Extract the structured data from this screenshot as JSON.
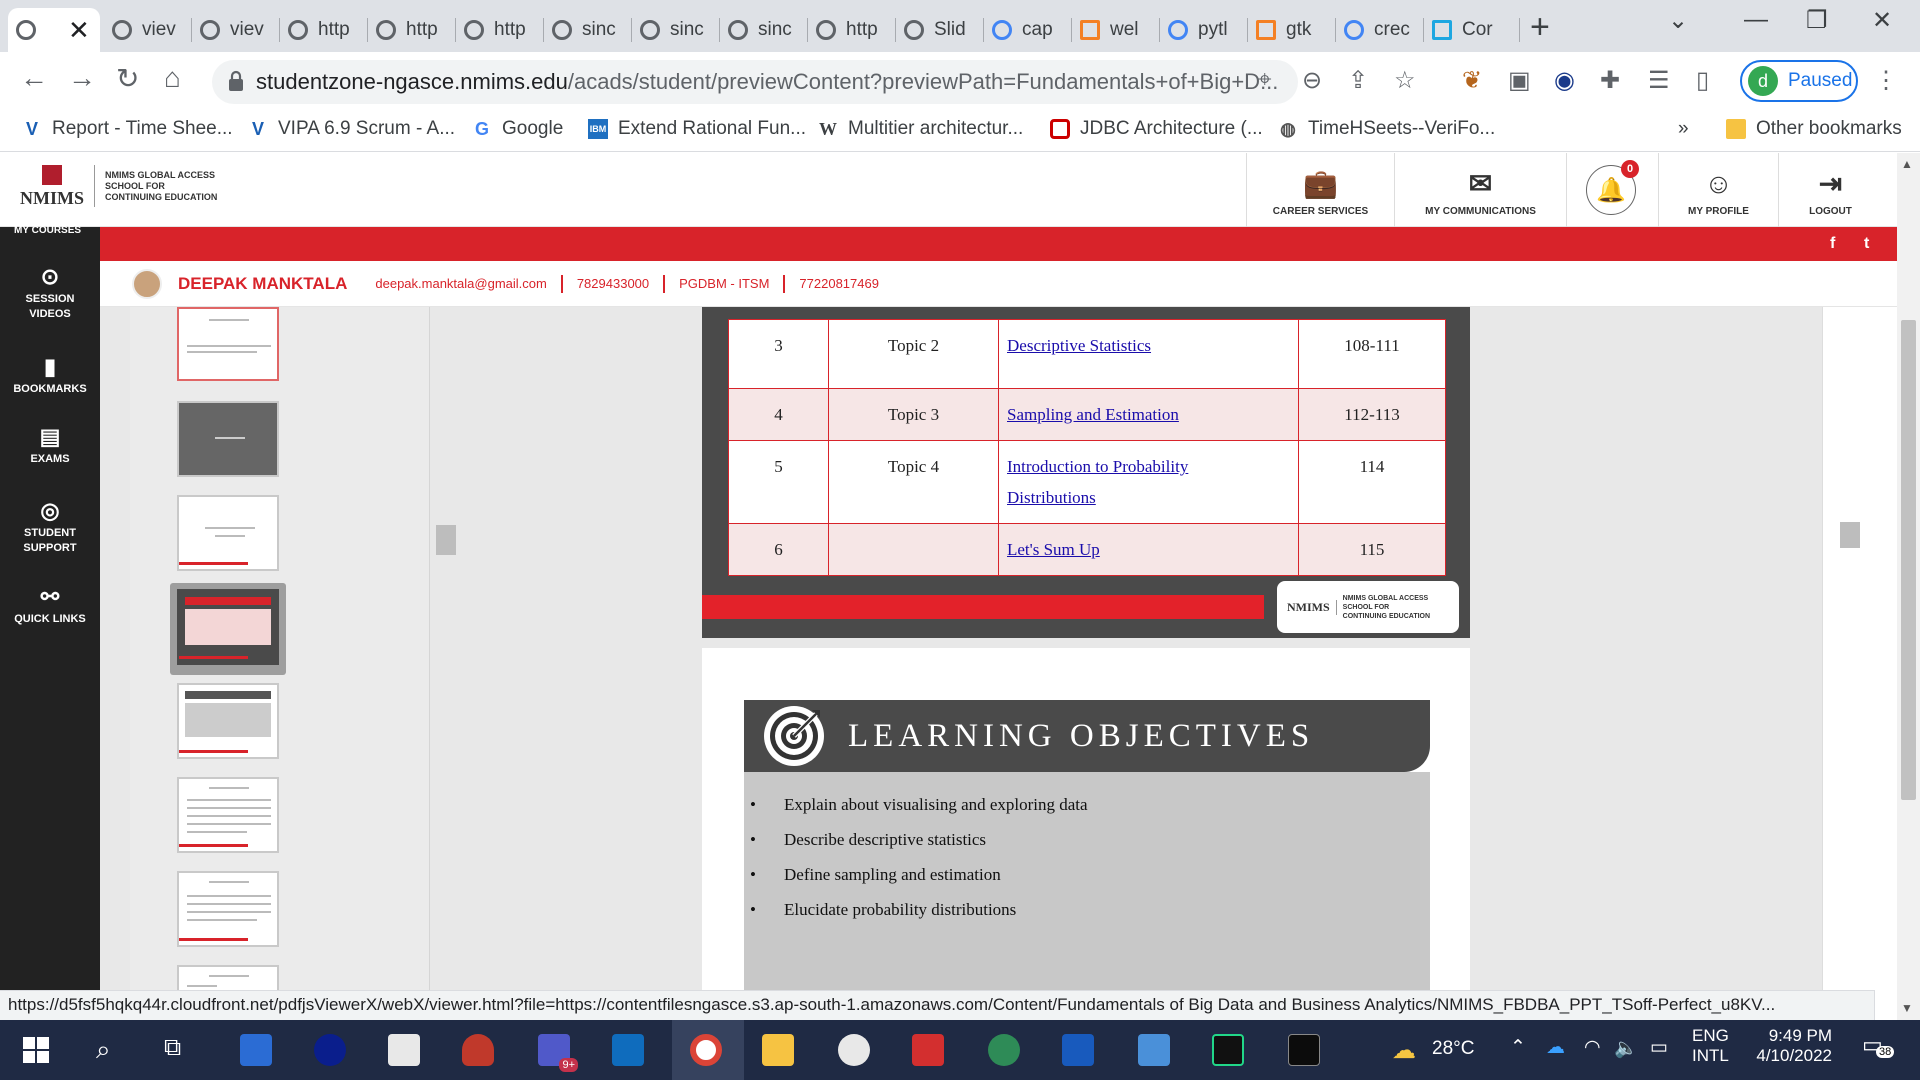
{
  "browser": {
    "tabs": [
      {
        "label": "",
        "active": true
      },
      {
        "label": "viev"
      },
      {
        "label": "viev"
      },
      {
        "label": "http"
      },
      {
        "label": "http"
      },
      {
        "label": "http"
      },
      {
        "label": "sinc"
      },
      {
        "label": "sinc"
      },
      {
        "label": "sinc"
      },
      {
        "label": "http"
      },
      {
        "label": "Slid"
      },
      {
        "label": "cap"
      },
      {
        "label": "wel"
      },
      {
        "label": "pytl"
      },
      {
        "label": "gtk"
      },
      {
        "label": "crec"
      },
      {
        "label": "Cor"
      }
    ],
    "url_host": "studentzone-ngasce.nmims.edu",
    "url_path": "/acads/student/previewContent?previewPath=Fundamentals+of+Big+D...",
    "profile_initial": "d",
    "profile_status": "Paused",
    "bookmarks": [
      {
        "label": "Report - Time Shee...",
        "icon": "v-icon"
      },
      {
        "label": "VIPA 6.9 Scrum - A...",
        "icon": "v-icon"
      },
      {
        "label": "Google",
        "icon": "google-icon"
      },
      {
        "label": "Extend Rational Fun...",
        "icon": "ibm-icon"
      },
      {
        "label": "Multitier architectur...",
        "icon": "wikipedia-icon"
      },
      {
        "label": "JDBC Architecture (...",
        "icon": "oracle-icon"
      },
      {
        "label": "TimeHSeets--VeriFo...",
        "icon": "globe-icon"
      }
    ],
    "bookmarks_overflow": "»",
    "other_bookmarks": "Other bookmarks",
    "status_url": "https://d5fsf5hqkq44r.cloudfront.net/pdfjsViewerX/webX/viewer.html?file=https://contentfilesngasce.s3.ap-south-1.amazonaws.com/Content/Fundamentals of Big Data and Business Analytics/NMIMS_FBDBA_PPT_TSoff-Perfect_u8KV..."
  },
  "site": {
    "logo_mark": "NMIMS",
    "logo_lines": [
      "NMIMS GLOBAL ACCESS",
      "SCHOOL FOR",
      "CONTINUING EDUCATION"
    ],
    "nav": [
      {
        "label": "CAREER SERVICES",
        "icon": "briefcase-icon"
      },
      {
        "label": "MY COMMUNICATIONS",
        "icon": "envelope-icon"
      },
      {
        "label": "MY PROFILE",
        "icon": "user-icon"
      },
      {
        "label": "LOGOUT",
        "icon": "logout-icon"
      }
    ],
    "notification_count": "0",
    "social": [
      "f",
      "t"
    ],
    "my_courses": "MY COURSES",
    "user": {
      "name": "DEEPAK MANKTALA",
      "email": "deepak.manktala@gmail.com",
      "phone": "7829433000",
      "program": "PGDBM - ITSM",
      "student_id": "77220817469"
    },
    "sidebar": [
      {
        "label_1": "SESSION",
        "label_2": "VIDEOS",
        "icon": "play-icon"
      },
      {
        "label_1": "BOOKMARKS",
        "label_2": "",
        "icon": "bookmark-icon"
      },
      {
        "label_1": "EXAMS",
        "label_2": "",
        "icon": "exam-icon"
      },
      {
        "label_1": "STUDENT",
        "label_2": "SUPPORT",
        "icon": "support-icon"
      },
      {
        "label_1": "QUICK LINKS",
        "label_2": "",
        "icon": "link-icon"
      }
    ]
  },
  "slide_index": {
    "rows": [
      {
        "num": "3",
        "topic": "Topic 2",
        "title_1": "Descriptive Statistics",
        "title_2": "",
        "pages": "108-111"
      },
      {
        "num": "4",
        "topic": "Topic 3",
        "title_1": "Sampling and Estimation",
        "title_2": "",
        "pages": "112-113"
      },
      {
        "num": "5",
        "topic": "Topic 4",
        "title_1": "Introduction to Probability",
        "title_2": "Distributions",
        "pages": "114"
      },
      {
        "num": "6",
        "topic": "",
        "title_1": "Let's Sum Up",
        "title_2": "",
        "pages": "115"
      }
    ],
    "footer_logo_mark": "NMIMS",
    "footer_logo_lines": [
      "NMIMS GLOBAL ACCESS",
      "SCHOOL FOR",
      "CONTINUING EDUCATION"
    ]
  },
  "slide_objectives": {
    "title": "LEARNING OBJECTIVES",
    "items": [
      "Explain about visualising and exploring data",
      "Describe descriptive statistics",
      "Define sampling and estimation",
      "Elucidate probability distributions"
    ]
  },
  "taskbar": {
    "weather": "28°C",
    "lang_1": "ENG",
    "lang_2": "INTL",
    "time": "9:49 PM",
    "date": "4/10/2022",
    "notifications": "38",
    "teams_badge": "9+"
  },
  "colors": {
    "brand_red": "#d8232a",
    "sidebar_dark": "#222222",
    "slide_dark": "#4a4a4a",
    "link_blue": "#1a0dab"
  }
}
